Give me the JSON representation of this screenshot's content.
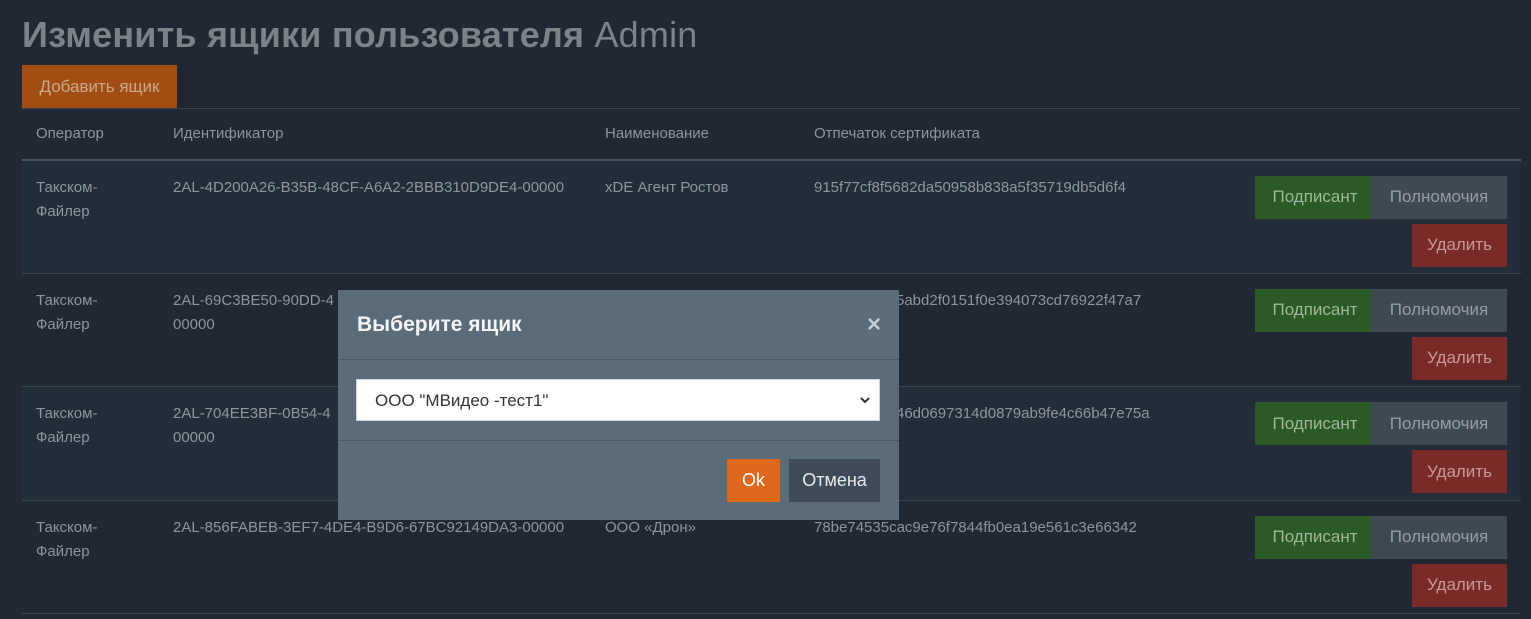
{
  "page": {
    "title_prefix": "Изменить ящики пользователя",
    "user": "Admin",
    "add_button": "Добавить ящик"
  },
  "table": {
    "columns": [
      "Оператор",
      "Идентификатор",
      "Наименование",
      "Отпечаток сертификата"
    ],
    "rows": [
      {
        "operator": "Такском-Файлер",
        "id": "2AL-4D200A26-B35B-48CF-A6A2-2BBB310D9DE4-00000",
        "name": "xDE Агент Ростов",
        "thumbprint": "915f77cf8f5682da50958b838a5f35719db5d6f4"
      },
      {
        "operator": "Такском-Файлер",
        "id": "2AL-69C3BE50-90DD-4",
        "id_line2": "00000",
        "name": "",
        "thumbprint": "5abd2f0151f0e394073cd76922f47a7"
      },
      {
        "operator": "Такском-Файлер",
        "id": "2AL-704EE3BF-0B54-4",
        "id_line2": "00000",
        "name": "",
        "thumbprint": "46d0697314d0879ab9fe4c66b47e75a"
      },
      {
        "operator": "Такском-Файлер",
        "id": "2AL-856FABEB-3EF7-4DE4-B9D6-67BC92149DA3-00000",
        "name": "ООО «Дрон»",
        "thumbprint": "78be74535cac9e76f7844fb0ea19e561c3e66342"
      }
    ],
    "actions": {
      "signer": "Подписант",
      "rights": "Полномочия",
      "delete": "Удалить"
    }
  },
  "modal": {
    "title": "Выберите ящик",
    "close_glyph": "×",
    "selected": "ООО \"МВидео -тест1\"",
    "ok": "Ok",
    "cancel": "Отмена"
  },
  "colors": {
    "background": "#1f2833",
    "add_button": "#a24d12",
    "signer": "#2c5a26",
    "rights": "#3f4954",
    "delete": "#7a2a27",
    "modal": "#5a6b7a",
    "ok": "#e0681a"
  }
}
